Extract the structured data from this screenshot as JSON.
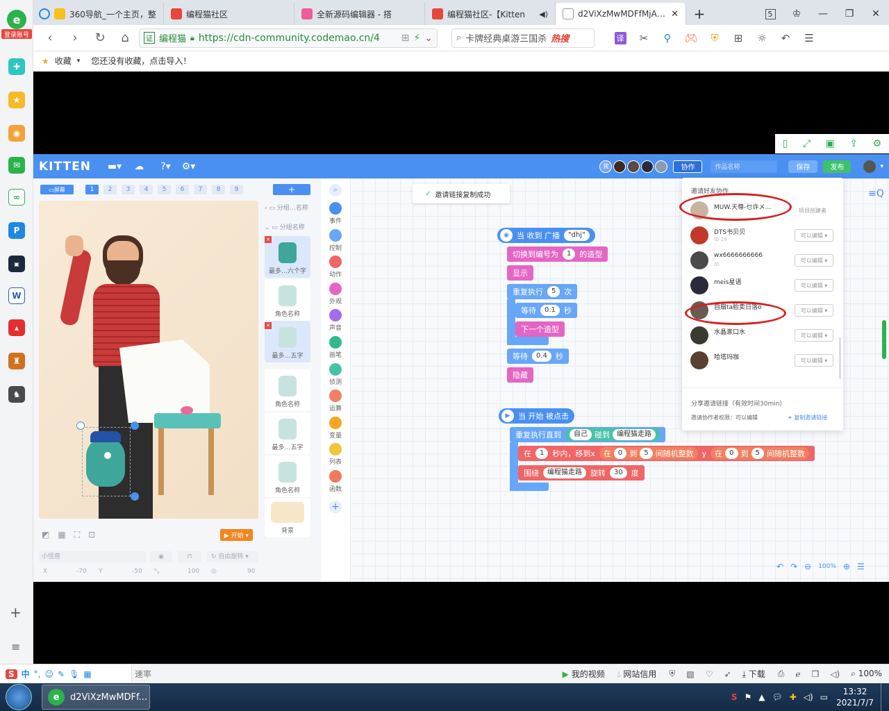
{
  "sidebar": {
    "login_label": "登录账号"
  },
  "tabs": [
    {
      "title": "360导航_一个主页，整",
      "fav_color": "#f6c31c"
    },
    {
      "title": "编程猫社区",
      "fav_color": "#e8453c"
    },
    {
      "title": "全新源码编辑器 - 搭",
      "fav_color": "#ec5d9b"
    },
    {
      "title": "编程猫社区-【Kitten",
      "fav_color": "#e8453c"
    },
    {
      "title": "d2ViXzMwMDFfMjAzN",
      "fav_color": "#999999"
    }
  ],
  "address": {
    "site_label": "编程猫",
    "url": "https://cdn-community.codemao.cn/4",
    "search_value": "卡牌经典桌游三国杀",
    "hot_label": "热搜"
  },
  "favorites": {
    "label": "收藏",
    "empty_text": "您还没有收藏，点击导入！"
  },
  "kitten": {
    "logo": "KITTEN",
    "collab_button": "协作",
    "work_name_placeholder": "作品名称",
    "save_button": "保存",
    "publish_button": "发布",
    "screen_label": "屏幕",
    "screens": [
      "1",
      "2",
      "3",
      "4",
      "5",
      "6",
      "7",
      "8",
      "9"
    ],
    "toast": "邀请链接复制成功",
    "groups": [
      "分组…名称",
      "分组名称"
    ],
    "sprites": [
      "最多…六个字",
      "角色名称",
      "最多…五字",
      "角色名称",
      "最多…五字",
      "角色名称",
      "背景"
    ],
    "categories": [
      {
        "label": "事件",
        "color": "#4a90f0"
      },
      {
        "label": "控制",
        "color": "#68a6f7"
      },
      {
        "label": "动作",
        "color": "#f06565"
      },
      {
        "label": "外观",
        "color": "#e565c5"
      },
      {
        "label": "声音",
        "color": "#a36cf0"
      },
      {
        "label": "画笔",
        "color": "#2fb98c"
      },
      {
        "label": "侦测",
        "color": "#48c2a6"
      },
      {
        "label": "运算",
        "color": "#f08060"
      },
      {
        "label": "变量",
        "color": "#f5a623"
      },
      {
        "label": "列表",
        "color": "#f3c33a"
      },
      {
        "label": "函数",
        "color": "#f07a5a"
      }
    ],
    "start_button": "开始",
    "sprite_name": "小怪兽",
    "rotate_mode": "自由旋转",
    "x_label": "X",
    "x_value": "-70",
    "y_label": "Y",
    "y_value": "-50",
    "size_value": "100",
    "dir_value": "90",
    "zoom": "100%",
    "blocks": {
      "when_receive": "当 收到 广播",
      "broadcast_value": "\"dhj\"",
      "switch_costume_pre": "切换到编号为",
      "switch_costume_value": "1",
      "switch_costume_post": "的造型",
      "show": "显示",
      "repeat_pre": "重复执行",
      "repeat_value": "5",
      "repeat_post": "次",
      "wait_label": "等待",
      "wait_value_1": "0.1",
      "sec_label": "秒",
      "next_costume": "下一个造型",
      "wait_value_2": "0.4",
      "hide": "隐藏",
      "when_start": "当 开始 被点击",
      "repeat_until": "重复执行直到",
      "self": "自己",
      "touch": "碰到",
      "target": "编程猫走路",
      "glide_in": "在",
      "glide_secs": "1",
      "glide_mid": "秒内，移到x",
      "in_label": "在",
      "x_from": "0",
      "to_label": "到",
      "x_to": "5",
      "random_int": "间随机整数",
      "y_label": "y",
      "y_from": "0",
      "y_to": "5",
      "orbit": "围绕",
      "orbit_target": "编程猫走路",
      "rotate": "旋转",
      "rotate_value": "30",
      "degree": "度"
    },
    "invite": {
      "title": "邀请好友协作",
      "creator_label": "项目创建者",
      "friends": [
        {
          "name": "MUW.天尊-乜许メ…",
          "perm": "",
          "id": ""
        },
        {
          "name": "DTS书贝贝",
          "perm": "可以编辑",
          "id": "ID 29"
        },
        {
          "name": "wx6666666666",
          "perm": "可以编辑",
          "id": "ID"
        },
        {
          "name": "meis星语",
          "perm": "可以编辑",
          "id": ""
        },
        {
          "name": "自扇ta脸卖日落o",
          "perm": "可以编辑",
          "id": ""
        },
        {
          "name": "水晶漱口水",
          "perm": "可以编辑",
          "id": ""
        },
        {
          "name": "哈塔玛咖",
          "perm": "可以编辑",
          "id": ""
        }
      ],
      "share_title": "分享邀请链接（有效时间30min）",
      "share_perm": "邀请协作者权限：可以编辑",
      "copy_link": "复制邀请链接"
    }
  },
  "statusbar": {
    "watermark": "速率",
    "my_video": "我的视频",
    "site_credit": "网站信用",
    "download": "下载",
    "zoom": "100%"
  },
  "taskbar": {
    "app_title": "d2ViXzMwMDFf...",
    "time": "13:32",
    "date": "2021/7/7"
  }
}
